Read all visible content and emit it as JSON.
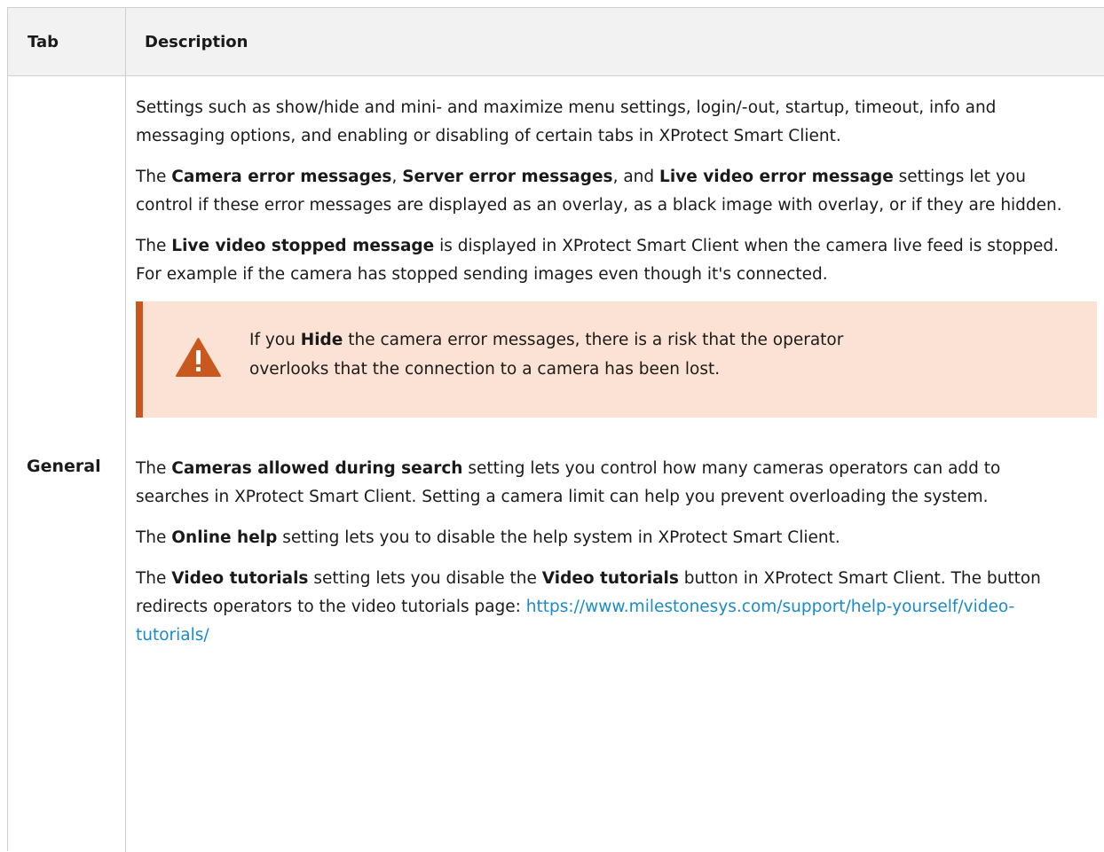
{
  "table": {
    "header": {
      "tab": "Tab",
      "description": "Description"
    },
    "row": {
      "tab": "General",
      "p1": "Settings such as show/hide and mini- and maximize menu settings, login/-out, startup, timeout, info and messaging options, and enabling or disabling of certain tabs in XProtect Smart Client.",
      "p2": {
        "t1": "The ",
        "b1": "Camera error messages",
        "t2": ", ",
        "b2": "Server error messages",
        "t3": ", and ",
        "b3": "Live video error message",
        "t4": " settings let you control if these error messages are displayed as an overlay, as a black image with overlay, or if they are hidden."
      },
      "p3": {
        "t1": "The ",
        "b1": "Live video stopped message",
        "t2": " is displayed in XProtect Smart Client when the camera live feed is stopped. For example if the camera has stopped sending images even though it's connected."
      },
      "warning": {
        "icon": "warning-triangle-icon",
        "t1": "If you ",
        "b1": "Hide",
        "t2": " the camera error messages, there is a risk that the operator overlooks that the connection to a camera has been lost."
      },
      "p4": {
        "t1": "The ",
        "b1": "Cameras allowed during search",
        "t2": " setting lets you control how many cameras operators can add to searches in XProtect Smart Client. Setting a camera limit can help you prevent overloading the system."
      },
      "p5": {
        "t1": "The ",
        "b1": "Online help",
        "t2": " setting lets you to disable the help system in XProtect Smart Client."
      },
      "p6": {
        "t1": "The ",
        "b1": "Video tutorials",
        "t2": " setting lets you disable the ",
        "b2": "Video tutorials",
        "t3": " button in XProtect Smart Client. The button redirects operators to the video tutorials page: ",
        "link": "https://www.milestonesys.com/support/help-yourself/video-tutorials/"
      }
    }
  },
  "colors": {
    "warning_bg": "#fce2d4",
    "warning_accent": "#c8581d",
    "link": "#1b8ac9",
    "header_bg": "#f2f2f2"
  }
}
